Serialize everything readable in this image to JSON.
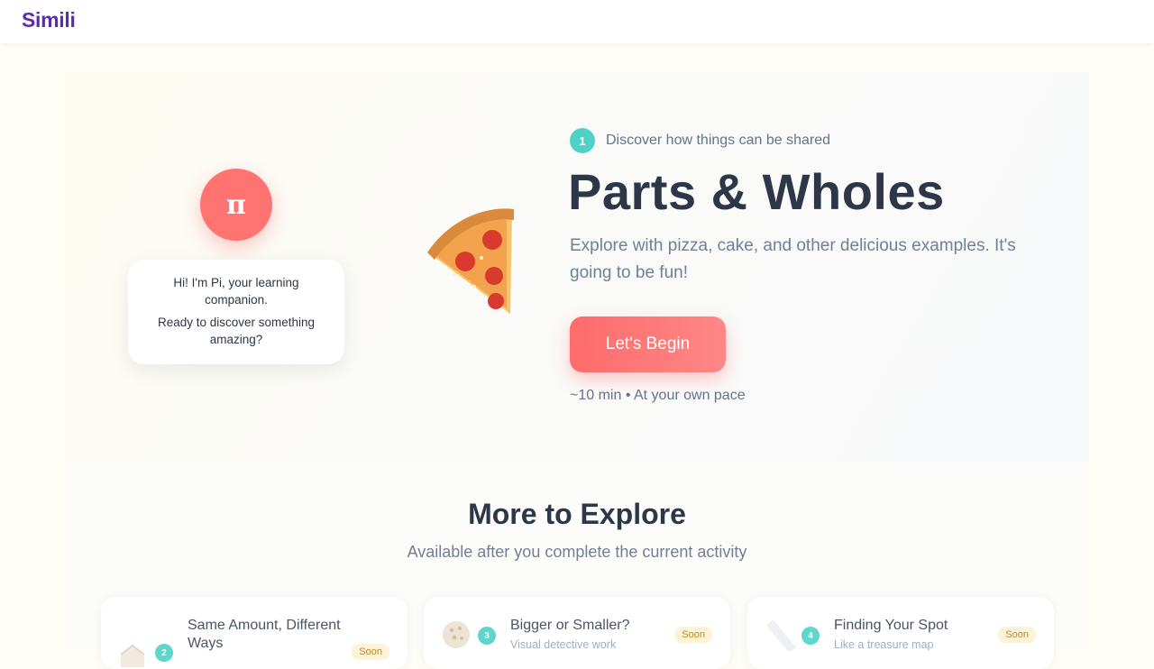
{
  "header": {
    "brand": "Simili"
  },
  "companion": {
    "avatar_symbol": "π",
    "message_line1": "Hi! I'm Pi, your learning companion.",
    "message_line2": "Ready to discover something amazing?"
  },
  "hero": {
    "step_number": "1",
    "step_text": "Discover how things can be shared",
    "title": "Parts & Wholes",
    "description": "Explore with pizza, cake, and other delicious examples. It's going to be fun!",
    "cta_label": "Let's Begin",
    "meta": "~10 min • At your own pace",
    "illustration": "pizza-slice-icon"
  },
  "explore": {
    "title": "More to Explore",
    "subtitle": "Available after you complete the current activity",
    "cards": [
      {
        "number": "2",
        "title": "Same Amount, Different Ways",
        "description": "",
        "badge": "Soon",
        "icon": "cake-icon"
      },
      {
        "number": "3",
        "title": "Bigger or Smaller?",
        "description": "Visual detective work",
        "badge": "Soon",
        "icon": "cookie-icon"
      },
      {
        "number": "4",
        "title": "Finding Your Spot",
        "description": "Like a treasure map",
        "badge": "Soon",
        "icon": "ruler-icon"
      }
    ]
  },
  "colors": {
    "brand": "#5b2bb0",
    "accent": "#ff6b6b",
    "step_badge": "#4fd1c5",
    "soon_badge_bg": "#fef3d6"
  }
}
